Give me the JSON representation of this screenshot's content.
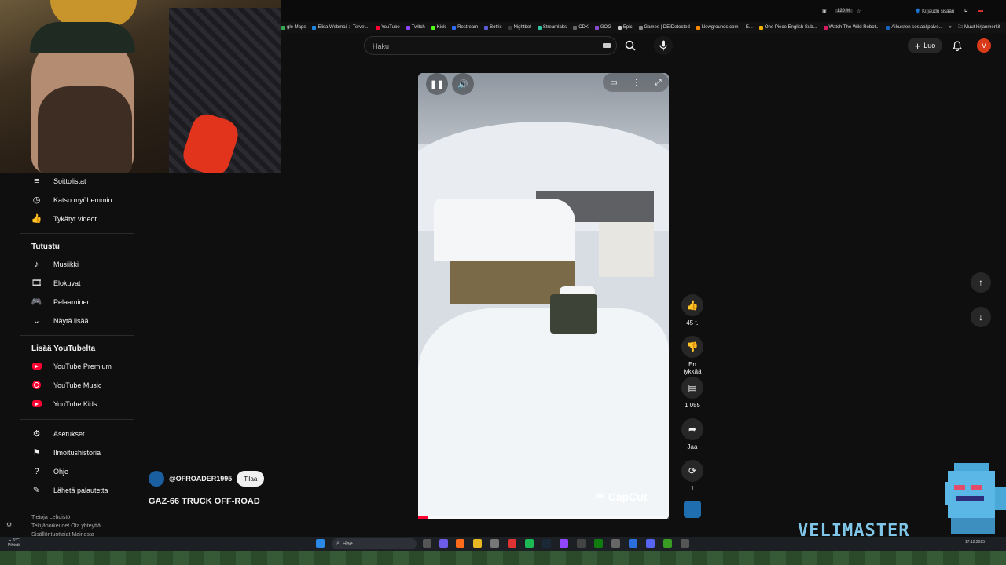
{
  "browser": {
    "zoom": "120 %",
    "signin": "Kirjaudu sisään",
    "bookmarks": [
      {
        "label": "gle Maps",
        "color": "#34a853"
      },
      {
        "label": "Elisa Webmail :: Tervet...",
        "color": "#1e88e5"
      },
      {
        "label": "YouTube",
        "color": "#ff0033"
      },
      {
        "label": "Twitch",
        "color": "#9146ff"
      },
      {
        "label": "Kick",
        "color": "#53fc18"
      },
      {
        "label": "Restream",
        "color": "#2f6df6"
      },
      {
        "label": "Botrix",
        "color": "#5b5bd6"
      },
      {
        "label": "Nightbot",
        "color": "#3b3b3b"
      },
      {
        "label": "Streamlabs",
        "color": "#31c3a2"
      },
      {
        "label": "CDK",
        "color": "#666666"
      },
      {
        "label": "GOG",
        "color": "#8b4bd1"
      },
      {
        "label": "Epic",
        "color": "#cccccc"
      },
      {
        "label": "Games | DEIDetected",
        "color": "#888888"
      },
      {
        "label": "Newgrounds.com — E...",
        "color": "#ff8a00"
      },
      {
        "label": "One Piece English Sub...",
        "color": "#f4b400"
      },
      {
        "label": "Watch The Wild Robot...",
        "color": "#d81b60"
      },
      {
        "label": "Aikuisten sosiaalipalve...",
        "color": "#1565c0"
      }
    ],
    "bookmarks_overflow": "»",
    "other_bookmarks": "Muut kirjanmerkit"
  },
  "header": {
    "search_placeholder": "Haku",
    "create_label": "Luo",
    "avatar_letter": "V"
  },
  "sidebar": {
    "you_items": [
      {
        "label": "Soittolistat",
        "icon": "playlist-icon"
      },
      {
        "label": "Katso myöhemmin",
        "icon": "clock-icon"
      },
      {
        "label": "Tykätyt videot",
        "icon": "thumbs-up-icon"
      }
    ],
    "explore_title": "Tutustu",
    "explore_items": [
      {
        "label": "Musiikki",
        "icon": "music-icon"
      },
      {
        "label": "Elokuvat",
        "icon": "film-icon"
      },
      {
        "label": "Pelaaminen",
        "icon": "gamepad-icon"
      },
      {
        "label": "Näytä lisää",
        "icon": "chevron-down-icon"
      }
    ],
    "more_title": "Lisää YouTubelta",
    "more_items": [
      {
        "label": "YouTube Premium"
      },
      {
        "label": "YouTube Music"
      },
      {
        "label": "YouTube Kids"
      }
    ],
    "settings_items": [
      {
        "label": "Asetukset",
        "icon": "gear-icon"
      },
      {
        "label": "Ilmoitushistoria",
        "icon": "flag-icon"
      },
      {
        "label": "Ohje",
        "icon": "help-icon"
      },
      {
        "label": "Lähetä palautetta",
        "icon": "feedback-icon"
      }
    ],
    "footer_line1": "Tietoja  Lehdistö",
    "footer_line2": "Tekijänoikeudet  Ota yhteyttä",
    "footer_line3": "Sisällöntuottajat  Mainosta"
  },
  "video": {
    "watermark": "CapCut",
    "progress": 0.04
  },
  "actions": {
    "likes": "45 t.",
    "dislike": "En tykkää",
    "comments": "1 055",
    "share": "Jaa",
    "remix": "1"
  },
  "channel": {
    "handle": "@OFROADER1995",
    "subscribe": "Tilaa",
    "title": "GAZ-66 TRUCK OFF-ROAD"
  },
  "overlay": {
    "streamer": "VELIMASTER"
  },
  "taskbar": {
    "search": "Hae",
    "weather_temp": "6°C",
    "weather_desc": "Pilvistä",
    "date": "17.12.2025"
  }
}
